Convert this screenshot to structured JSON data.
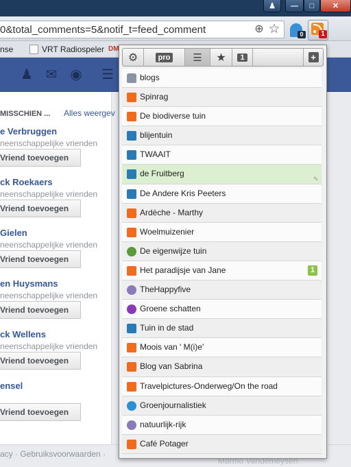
{
  "browser": {
    "address_text": "0&total_comments=5&notif_t=feed_comment",
    "ghost_badge": "0",
    "rss_badge": "1",
    "colors": {
      "titlebar": "#1e3a5c",
      "close": "#c0392b",
      "rss": "#f08a24"
    }
  },
  "bookmarks": {
    "left_fragment": "nse",
    "radio_label": "VRT Radiospeler",
    "dm_label": "DM"
  },
  "facebook": {
    "sidebar_heading": "MISSCHIEN ...",
    "sidebar_link": "Alles weergev",
    "friends": [
      {
        "name": "e Verbruggen",
        "mutual": "neenschappelijke vrienden",
        "button": "Vriend toevoegen"
      },
      {
        "name": "ck Roekaers",
        "mutual": "neenschappelijke vrienden",
        "button": "Vriend toevoegen"
      },
      {
        "name": "Gielen",
        "mutual": "neenschappelijke vrienden",
        "button": "Vriend toevoegen"
      },
      {
        "name": "en Huysmans",
        "mutual": "neenschappelijke vrienden",
        "button": "Vriend toevoegen"
      },
      {
        "name": "ck Wellens",
        "mutual": "neenschappelijke vrienden",
        "button": "Vriend toevoegen"
      },
      {
        "name": "ensel",
        "mutual": "",
        "button": "Vriend toevoegen"
      }
    ],
    "footer_text": "acy · Gebruiksvoorwaarden ·",
    "footer_right": "Marmo Vandemeysen"
  },
  "popup": {
    "toolbar": {
      "pro": "pro",
      "one": "1",
      "add": "+"
    },
    "feeds": [
      {
        "label": "blogs",
        "icon": "folder-icon",
        "color": "#8a94a4"
      },
      {
        "label": "Spinrag",
        "icon": "blogger-icon",
        "color": "#ef6c1f"
      },
      {
        "label": "De biodiverse tuin",
        "icon": "blogger-icon",
        "color": "#ef6c1f"
      },
      {
        "label": "blijentuin",
        "icon": "wordpress-icon",
        "color": "#2a7ab8"
      },
      {
        "label": "TWAAIT",
        "icon": "wordpress-icon",
        "color": "#2a7ab8"
      },
      {
        "label": "de Fruitberg",
        "icon": "wordpress-icon",
        "color": "#2a7ab8"
      },
      {
        "label": "De Andere Kris Peeters",
        "icon": "wordpress-icon",
        "color": "#2a7ab8"
      },
      {
        "label": "Ardèche - Marthy",
        "icon": "blogger-icon",
        "color": "#ef6c1f"
      },
      {
        "label": "Woelmuizenier",
        "icon": "blogger-icon",
        "color": "#ef6c1f"
      },
      {
        "label": "De eigenwijze tuin",
        "icon": "leaf-icon",
        "color": "#5a9a3a"
      },
      {
        "label": "Het paradijsje van Jane",
        "icon": "blogger-icon",
        "color": "#ef6c1f",
        "unread": "1"
      },
      {
        "label": "TheHappyfive",
        "icon": "globe-icon",
        "color": "#8a7ab8"
      },
      {
        "label": "Groene schatten",
        "icon": "speech-bubble-icon",
        "color": "#8a3ab8"
      },
      {
        "label": "Tuin in de stad",
        "icon": "wordpress-icon",
        "color": "#2a7ab8"
      },
      {
        "label": "Moois van ' M(i)e'",
        "icon": "blogger-icon",
        "color": "#ef6c1f"
      },
      {
        "label": "Blog van Sabrina",
        "icon": "blogger-icon",
        "color": "#ef6c1f"
      },
      {
        "label": "Travelpictures-Onderweg/On the road",
        "icon": "blogger-icon",
        "color": "#ef6c1f"
      },
      {
        "label": "Groenjournalistiek",
        "icon": "globe-icon",
        "color": "#2a8fd6"
      },
      {
        "label": "natuurlijk-rijk",
        "icon": "globe-icon",
        "color": "#8a7ab8"
      },
      {
        "label": "Café Potager",
        "icon": "blogger-icon",
        "color": "#ef6c1f"
      }
    ]
  }
}
